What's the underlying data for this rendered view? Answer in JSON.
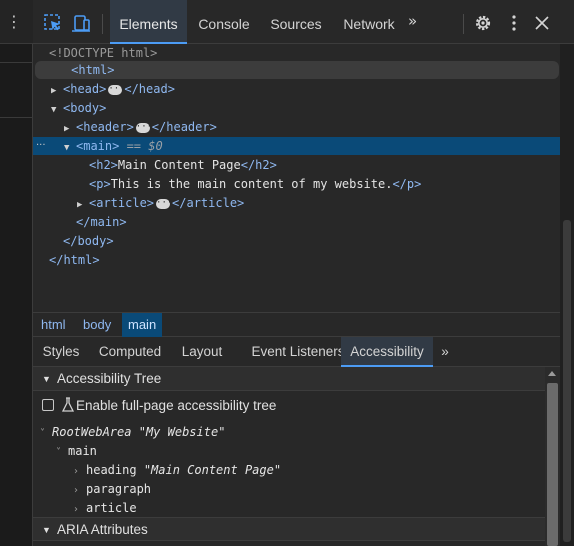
{
  "toolbar": {
    "tabs": [
      {
        "label": "Elements",
        "active": true
      },
      {
        "label": "Console",
        "active": false
      },
      {
        "label": "Sources",
        "active": false
      },
      {
        "label": "Network",
        "active": false
      }
    ],
    "more_tabs": "»",
    "icons": [
      "inspect-element-icon",
      "device-toolbar-icon",
      "settings-gear-icon",
      "more-options-icon",
      "close-icon"
    ],
    "accent": "#4c9cf5"
  },
  "dom": {
    "doctype": "<!DOCTYPE html>",
    "html_open": "<html>",
    "head_open": "<head>",
    "head_close": "</head>",
    "body_open": "<body>",
    "header_open": "<header>",
    "header_close": "</header>",
    "main_open": "<main>",
    "main_suffix": " == $0",
    "h2_open": "<h2>",
    "h2_text": "Main Content Page",
    "h2_close": "</h2>",
    "p_open": "<p>",
    "p_text": "This is the main content of my website.",
    "p_close": "</p>",
    "article_open": "<article>",
    "article_close": "</article>",
    "main_close": "</main>",
    "body_close": "</body>",
    "html_close": "</html>",
    "gutter": "···",
    "selection_color": "#0a4a78"
  },
  "breadcrumbs": [
    {
      "label": "html",
      "active": false
    },
    {
      "label": "body",
      "active": false
    },
    {
      "label": "main",
      "active": true
    }
  ],
  "subtabs": [
    {
      "label": "Styles",
      "active": false
    },
    {
      "label": "Computed",
      "active": false
    },
    {
      "label": "Layout",
      "active": false
    },
    {
      "label": "Event Listeners",
      "active": false
    },
    {
      "label": "Accessibility",
      "active": true
    }
  ],
  "subtabs_more": "»",
  "accessibility": {
    "tree_header": "Accessibility Tree",
    "checkbox_label": "Enable full-page accessibility tree",
    "checkbox_checked": false,
    "root_role": "RootWebArea",
    "root_name": "\"My Website\"",
    "main_role": "main",
    "children": [
      {
        "role": "heading",
        "name": "\"Main Content Page\""
      },
      {
        "role": "paragraph",
        "name": ""
      },
      {
        "role": "article",
        "name": ""
      }
    ],
    "aria_header": "ARIA Attributes"
  }
}
